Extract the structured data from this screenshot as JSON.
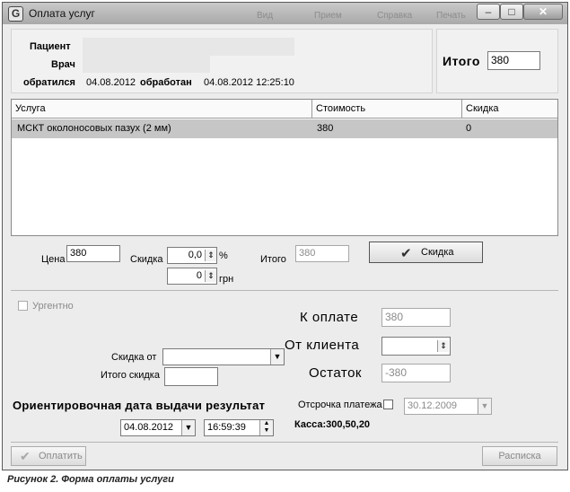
{
  "window": {
    "title": "Оплата услуг",
    "ghost_left": "Вид",
    "ghost_mid": "Прием",
    "ghost_right": "Справка",
    "ghost_far": "Печать",
    "min_glyph": "–",
    "max_glyph": "□",
    "close_glyph": "✕",
    "icon_glyph": "G"
  },
  "patient": {
    "patient_label": "Пациент",
    "doctor_label": "Врач",
    "applied_label": "обратился",
    "applied_date": "04.08.2012",
    "processed_label": "обработан",
    "processed_datetime": "04.08.2012 12:25:10"
  },
  "total_top": {
    "label": "Итого",
    "value": "380"
  },
  "table": {
    "columns": [
      "Услуга",
      "Стоимость",
      "Скидка"
    ],
    "rows": [
      [
        "МСКТ околоносовых пазух (2 мм)",
        "380",
        "0"
      ]
    ]
  },
  "edit": {
    "price_label": "Цена",
    "price_value": "380",
    "discount_label": "Скидка",
    "discount_pct_value": "0,0",
    "pct_sign": "%",
    "discount_uah_value": "0",
    "uah_sign": "грн",
    "total_label": "Итого",
    "total_value": "380",
    "discount_button": "Скидка",
    "spin_glyph": "⇕"
  },
  "payment": {
    "urgent_label": "Ургентно",
    "to_pay_label": "К оплате",
    "to_pay_value": "380",
    "from_client_label": "От клиента",
    "from_client_value": "",
    "remainder_label": "Остаток",
    "remainder_value": "-380",
    "discount_from_label": "Скидка от",
    "discount_from_value": "",
    "total_discount_label": "Итого скидка",
    "total_discount_value": "",
    "result_date_label": "Ориентировочная дата выдачи результат",
    "result_date": "04.08.2012",
    "result_time": "16:59:39",
    "deferral_label": "Отсрочка платежа",
    "deferral_date": "30.12.2009",
    "cashbox_text": "Касса:300,50,20"
  },
  "footer": {
    "pay_button": "Оплатить",
    "receipt_button": "Расписка"
  },
  "caption": "Рисунок 2. Форма оплаты услуги"
}
